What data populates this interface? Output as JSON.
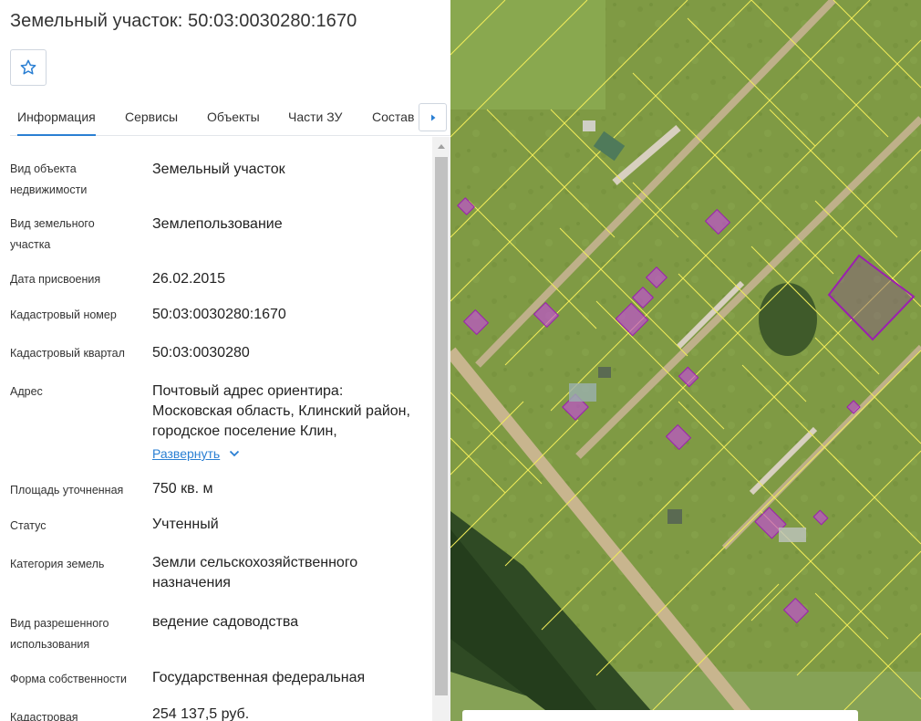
{
  "header": {
    "title": "Земельный участок: 50:03:0030280:1670"
  },
  "tabs": [
    {
      "label": "Информация",
      "active": true
    },
    {
      "label": "Сервисы",
      "active": false
    },
    {
      "label": "Объекты",
      "active": false
    },
    {
      "label": "Части ЗУ",
      "active": false
    },
    {
      "label": "Состав",
      "active": false
    }
  ],
  "info": [
    {
      "label": "Вид объекта недвижимости",
      "value": "Земельный участок"
    },
    {
      "label": "Вид земельного участка",
      "value": "Землепользование"
    },
    {
      "label": "Дата присвоения",
      "value": "26.02.2015"
    },
    {
      "label": "Кадастровый номер",
      "value": "50:03:0030280:1670"
    },
    {
      "label": "Кадастровый квартал",
      "value": "50:03:0030280"
    },
    {
      "label": "Адрес",
      "value": "Почтовый адрес ориентира: Московская область, Клинский район, городское поселение Клин,"
    },
    {
      "label": "Площадь уточненная",
      "value": "750 кв. м"
    },
    {
      "label": "Статус",
      "value": "Учтенный"
    },
    {
      "label": "Категория земель",
      "value": "Земли сельскохозяйственного назначения"
    },
    {
      "label": "Вид разрешенного использования",
      "value": "ведение садоводства"
    },
    {
      "label": "Форма собственности",
      "value": "Государственная федеральная"
    },
    {
      "label": "Кадастровая",
      "value": "254 137,5 руб."
    }
  ],
  "address_expand": "Развернуть",
  "colors": {
    "accent": "#2a7fd3",
    "parcel_line": "#f2ec5a",
    "highlight": "#9b1fb0",
    "building": "#c44bd9"
  },
  "icons": {
    "favorite": "star-icon",
    "tabs_next": "chevron-right-icon",
    "expand": "chevron-down-icon"
  }
}
